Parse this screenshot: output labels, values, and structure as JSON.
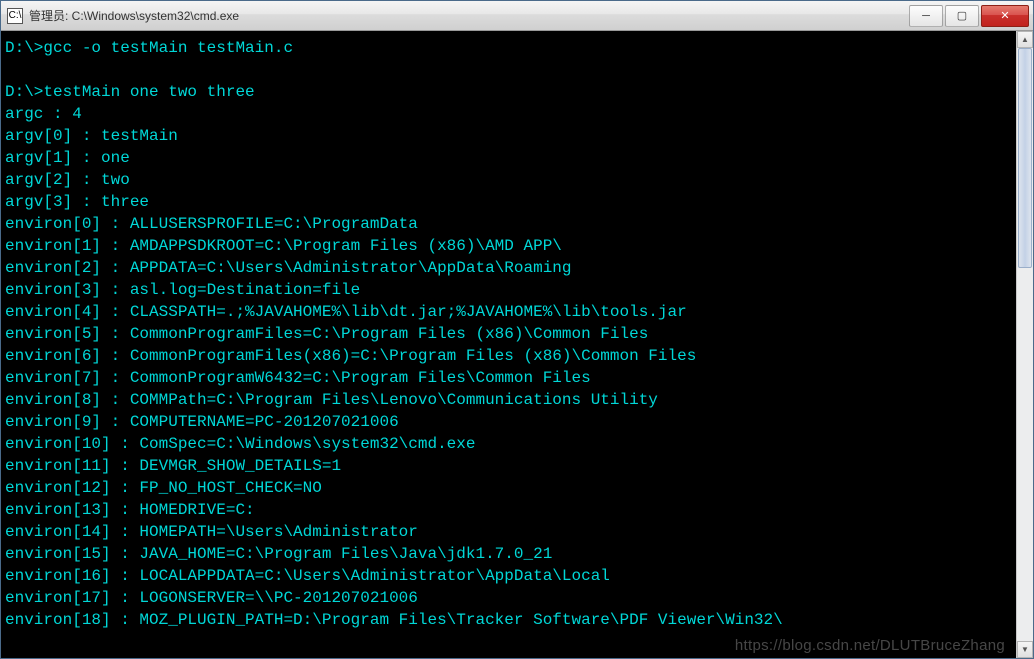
{
  "window": {
    "title": "管理员: C:\\Windows\\system32\\cmd.exe",
    "icon_label": "C:\\"
  },
  "buttons": {
    "minimize": "─",
    "maximize": "▢",
    "close": "✕"
  },
  "scrollbar": {
    "up": "▲",
    "down": "▼"
  },
  "lines": [
    {
      "text": "D:\\>gcc -o testMain testMain.c"
    },
    {
      "text": ""
    },
    {
      "text": "D:\\>testMain one two three"
    },
    {
      "text": "argc : 4"
    },
    {
      "text": "argv[0] : testMain"
    },
    {
      "text": "argv[1] : one"
    },
    {
      "text": "argv[2] : two"
    },
    {
      "text": "argv[3] : three"
    },
    {
      "text": "environ[0] : ALLUSERSPROFILE=C:\\ProgramData"
    },
    {
      "text": "environ[1] : AMDAPPSDKROOT=C:\\Program Files (x86)\\AMD APP\\"
    },
    {
      "text": "environ[2] : APPDATA=C:\\Users\\Administrator\\AppData\\Roaming"
    },
    {
      "text": "environ[3] : asl.log=Destination=file"
    },
    {
      "text": "environ[4] : CLASSPATH=.;%JAVAHOME%\\lib\\dt.jar;%JAVAHOME%\\lib\\tools.jar"
    },
    {
      "text": "environ[5] : CommonProgramFiles=C:\\Program Files (x86)\\Common Files"
    },
    {
      "text": "environ[6] : CommonProgramFiles(x86)=C:\\Program Files (x86)\\Common Files"
    },
    {
      "text": "environ[7] : CommonProgramW6432=C:\\Program Files\\Common Files"
    },
    {
      "text": "environ[8] : COMMPath=C:\\Program Files\\Lenovo\\Communications Utility"
    },
    {
      "text": "environ[9] : COMPUTERNAME=PC-201207021006"
    },
    {
      "text": "environ[10] : ComSpec=C:\\Windows\\system32\\cmd.exe"
    },
    {
      "text": "environ[11] : DEVMGR_SHOW_DETAILS=1"
    },
    {
      "text": "environ[12] : FP_NO_HOST_CHECK=NO"
    },
    {
      "text": "environ[13] : HOMEDRIVE=C:"
    },
    {
      "text": "environ[14] : HOMEPATH=\\Users\\Administrator"
    },
    {
      "text": "environ[15] : JAVA_HOME=C:\\Program Files\\Java\\jdk1.7.0_21"
    },
    {
      "text": "environ[16] : LOCALAPPDATA=C:\\Users\\Administrator\\AppData\\Local"
    },
    {
      "text": "environ[17] : LOGONSERVER=\\\\PC-201207021006"
    },
    {
      "text": "environ[18] : MOZ_PLUGIN_PATH=D:\\Program Files\\Tracker Software\\PDF Viewer\\Win32\\"
    }
  ],
  "watermark": "https://blog.csdn.net/DLUTBruceZhang"
}
